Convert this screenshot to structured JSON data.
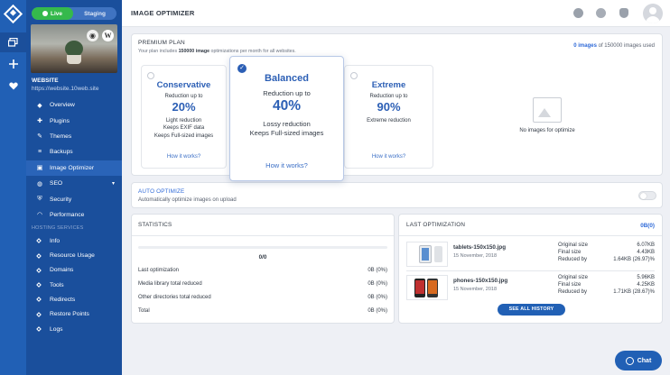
{
  "sidebar": {
    "env_live": "Live",
    "env_staging": "Staging",
    "site_title": "WEBSITE",
    "site_url": "https://website.10web.site",
    "nav": [
      {
        "label": "Overview",
        "icon": "cube-icon"
      },
      {
        "label": "Plugins",
        "icon": "plug-icon"
      },
      {
        "label": "Themes",
        "icon": "brush-icon"
      },
      {
        "label": "Backups",
        "icon": "stack-icon"
      },
      {
        "label": "Image Optimizer",
        "icon": "image-icon",
        "active": true
      },
      {
        "label": "SEO",
        "icon": "seo-icon"
      },
      {
        "label": "Security",
        "icon": "shield-icon"
      },
      {
        "label": "Performance",
        "icon": "gauge-icon"
      }
    ],
    "section_label": "HOSTING SERVICES",
    "hosting": [
      "Info",
      "Resource Usage",
      "Domains",
      "Tools",
      "Redirects",
      "Restore Points",
      "Logs"
    ]
  },
  "header": {
    "title": "IMAGE OPTIMIZER"
  },
  "plan": {
    "label": "PREMIUM PLAN",
    "desc_pre": "Your plan includes ",
    "desc_num": "150000 image",
    "desc_post": " optimizations per month for all websites.",
    "used_count": "0 images",
    "used_rest": " of 150000 images used",
    "options": {
      "conservative": {
        "name": "Conservative",
        "up_to": "Reduction up to",
        "pct": "20%",
        "lines": [
          "Light reduction",
          "Keeps EXIF data",
          "Keeps Full-sized images"
        ],
        "how": "How it works?"
      },
      "balanced": {
        "name": "Balanced",
        "up_to": "Reduction up to",
        "pct": "40%",
        "lines": [
          "Lossy reduction",
          "Keeps Full-sized images"
        ],
        "how": "How it works?"
      },
      "extreme": {
        "name": "Extreme",
        "up_to": "Reduction up to",
        "pct": "90%",
        "lines": [
          "Extreme reduction"
        ],
        "how": "How it works?"
      }
    },
    "no_images": "No images for optimize"
  },
  "auto": {
    "title": "AUTO OPTIMIZE",
    "desc": "Automatically optimize images on upload"
  },
  "stats": {
    "title": "STATISTICS",
    "progress": 0,
    "fraction": "0/0",
    "rows": [
      {
        "label": "Last optimization",
        "value": "0B (0%)"
      },
      {
        "label": "Media library total reduced",
        "value": "0B (0%)"
      },
      {
        "label": "Other directories total reduced",
        "value": "0B (0%)"
      },
      {
        "label": "Total",
        "value": "0B (0%)"
      }
    ]
  },
  "last": {
    "title": "LAST OPTIMIZATION",
    "size": "0B(0)",
    "items": [
      {
        "name": "tablets-150x150.jpg",
        "date": "15 November, 2018",
        "orig_label": "Original size",
        "orig": "6.07KB",
        "final_label": "Final size",
        "final": "4.43KB",
        "red_label": "Reduced by",
        "reduced": "1.64KB (26.97)%"
      },
      {
        "name": "phones-150x150.jpg",
        "date": "15 November, 2018",
        "orig_label": "Original size",
        "orig": "5.96KB",
        "final_label": "Final size",
        "final": "4.25KB",
        "red_label": "Reduced by",
        "reduced": "1.71KB (28.67)%"
      }
    ],
    "see_all": "SEE ALL HISTORY"
  },
  "chat": "Chat",
  "colors": {
    "brand": "#2160b5",
    "sidebar": "#1a4f9c",
    "accent": "#2f6ad8",
    "live": "#35b94c"
  }
}
